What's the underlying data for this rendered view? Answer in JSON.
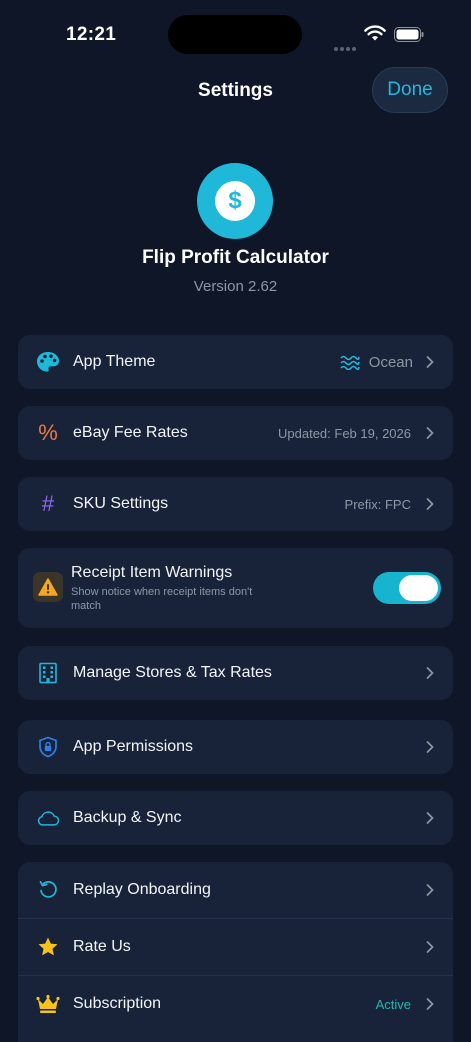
{
  "status_bar": {
    "time": "12:21"
  },
  "nav": {
    "title": "Settings",
    "done_label": "Done"
  },
  "app": {
    "icon_glyph": "$",
    "name": "Flip Profit Calculator",
    "version": "Version 2.62"
  },
  "rows": {
    "app_theme": {
      "label": "App Theme",
      "value": "Ocean"
    },
    "ebay_fee_rates": {
      "label": "eBay Fee Rates",
      "value": "Updated: Feb 19, 2026"
    },
    "sku_settings": {
      "label": "SKU Settings",
      "value": "Prefix: FPC"
    },
    "receipt_warnings": {
      "label": "Receipt Item Warnings",
      "sublabel": "Show notice when receipt items don't match",
      "enabled": true
    },
    "manage_stores": {
      "label": "Manage Stores & Tax Rates"
    },
    "app_permissions": {
      "label": "App Permissions"
    },
    "backup_sync": {
      "label": "Backup & Sync"
    },
    "replay_onboarding": {
      "label": "Replay Onboarding"
    },
    "rate_us": {
      "label": "Rate Us"
    },
    "subscription": {
      "label": "Subscription",
      "value": "Active"
    }
  },
  "icons": {
    "app_theme": "palette-icon",
    "theme_value": "waves-icon",
    "ebay_fee_rates": "percent-icon",
    "sku_settings": "hash-icon",
    "receipt_warnings": "warning-icon",
    "manage_stores": "building-icon",
    "app_permissions": "shield-lock-icon",
    "backup_sync": "cloud-icon",
    "replay_onboarding": "replay-icon",
    "rate_us": "star-icon",
    "subscription": "crown-icon"
  },
  "colors": {
    "background": "#0e1627",
    "card": "#18233a",
    "accent": "#1fb8d9",
    "orange": "#f07b3f",
    "purple": "#8a6cf0",
    "gold": "#f5c31b",
    "active": "#1fb8b0"
  }
}
